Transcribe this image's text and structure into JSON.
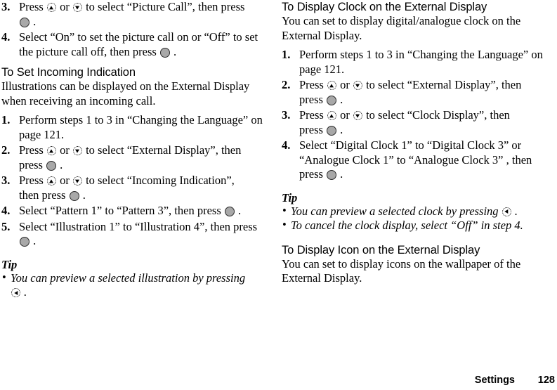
{
  "page": {
    "footer": {
      "chapter": "Settings",
      "page_number": "128"
    }
  },
  "icons": {
    "up": "nav-up-key-icon",
    "down": "nav-down-key-icon",
    "left": "nav-left-key-icon",
    "center": "center-select-key-icon",
    "bullet": "•"
  },
  "left_column": {
    "continued_steps": [
      {
        "num": "3.",
        "lines": [
          {
            "pre": "Press ",
            "icon1": "up",
            "mid": " or ",
            "icon2": "down",
            "post": " to select “Picture Call”, then press"
          },
          {
            "icon_only": "center",
            "post": " ."
          }
        ]
      },
      {
        "num": "4.",
        "lines": [
          {
            "text": "Select “On” to set the picture call on or “Off” to set"
          },
          {
            "pre": "the picture call off, then press ",
            "icon_only": "center",
            "post": " ."
          }
        ]
      }
    ],
    "heading": "To Set Incoming Indication",
    "intro": "Illustrations can be displayed on the External Display when receiving an incoming call.",
    "steps": [
      {
        "num": "1.",
        "lines": [
          {
            "text": "Perform steps 1 to 3 in “Changing the Language” on"
          },
          {
            "text": "page 121."
          }
        ]
      },
      {
        "num": "2.",
        "lines": [
          {
            "pre": "Press ",
            "icon1": "up",
            "mid": " or ",
            "icon2": "down",
            "post": " to select “External Display”, then"
          },
          {
            "pre": "press ",
            "icon_only": "center",
            "post": " ."
          }
        ]
      },
      {
        "num": "3.",
        "lines": [
          {
            "pre": "Press ",
            "icon1": "up",
            "mid": " or ",
            "icon2": "down",
            "post": " to select “Incoming Indication”,"
          },
          {
            "pre": "then press ",
            "icon_only": "center",
            "post": " ."
          }
        ]
      },
      {
        "num": "4.",
        "lines": [
          {
            "pre": "Select “Pattern 1” to “Pattern 3”, then press ",
            "icon_only": "center",
            "post": " ."
          }
        ]
      },
      {
        "num": "5.",
        "lines": [
          {
            "text": "Select “Illustration 1” to “Illustration 4”, then press"
          },
          {
            "icon_only": "center",
            "post": " ."
          }
        ]
      }
    ],
    "tip_title": "Tip",
    "tips": [
      {
        "lines": [
          {
            "text": "You can preview a selected illustration by pressing"
          },
          {
            "icon_only": "left",
            "post": " ."
          }
        ]
      }
    ]
  },
  "right_column": {
    "heading_1": "To Display Clock on the External Display",
    "intro_1": "You can set to display digital/analogue clock on the External Display.",
    "steps": [
      {
        "num": "1.",
        "lines": [
          {
            "text": "Perform steps 1 to 3 in “Changing the Language” on"
          },
          {
            "text": "page 121."
          }
        ]
      },
      {
        "num": "2.",
        "lines": [
          {
            "pre": "Press ",
            "icon1": "up",
            "mid": " or ",
            "icon2": "down",
            "post": " to select “External Display”, then"
          },
          {
            "pre": "press ",
            "icon_only": "center",
            "post": " ."
          }
        ]
      },
      {
        "num": "3.",
        "lines": [
          {
            "pre": "Press ",
            "icon1": "up",
            "mid": " or ",
            "icon2": "down",
            "post": " to select “Clock Display”, then"
          },
          {
            "pre": "press ",
            "icon_only": "center",
            "post": " ."
          }
        ]
      },
      {
        "num": "4.",
        "lines": [
          {
            "text": "Select “Digital Clock 1” to “Digital Clock 3” or"
          },
          {
            "text": "“Analogue Clock 1” to “Analogue Clock 3” , then"
          },
          {
            "pre": "press ",
            "icon_only": "center",
            "post": " ."
          }
        ]
      }
    ],
    "tip_title": "Tip",
    "tips": [
      {
        "lines": [
          {
            "pre": "You can preview a selected clock by pressing ",
            "icon_only": "left",
            "post": " ."
          }
        ]
      },
      {
        "lines": [
          {
            "text": "To cancel the clock display, select “Off” in step 4."
          }
        ]
      }
    ],
    "heading_2": "To Display Icon on the External Display",
    "intro_2": "You can set to display icons on the wallpaper of the External Display."
  }
}
